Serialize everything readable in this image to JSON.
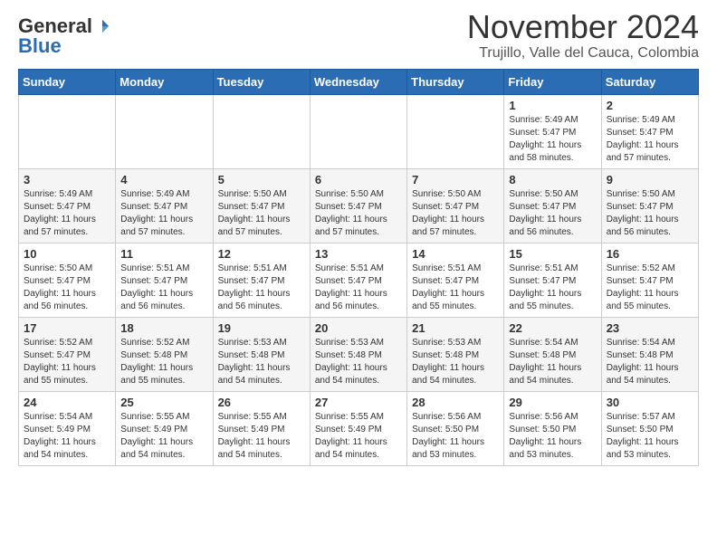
{
  "header": {
    "logo_general": "General",
    "logo_blue": "Blue",
    "title": "November 2024",
    "subtitle": "Trujillo, Valle del Cauca, Colombia"
  },
  "calendar": {
    "headers": [
      "Sunday",
      "Monday",
      "Tuesday",
      "Wednesday",
      "Thursday",
      "Friday",
      "Saturday"
    ],
    "weeks": [
      [
        {
          "day": "",
          "info": ""
        },
        {
          "day": "",
          "info": ""
        },
        {
          "day": "",
          "info": ""
        },
        {
          "day": "",
          "info": ""
        },
        {
          "day": "",
          "info": ""
        },
        {
          "day": "1",
          "info": "Sunrise: 5:49 AM\nSunset: 5:47 PM\nDaylight: 11 hours\nand 58 minutes."
        },
        {
          "day": "2",
          "info": "Sunrise: 5:49 AM\nSunset: 5:47 PM\nDaylight: 11 hours\nand 57 minutes."
        }
      ],
      [
        {
          "day": "3",
          "info": "Sunrise: 5:49 AM\nSunset: 5:47 PM\nDaylight: 11 hours\nand 57 minutes."
        },
        {
          "day": "4",
          "info": "Sunrise: 5:49 AM\nSunset: 5:47 PM\nDaylight: 11 hours\nand 57 minutes."
        },
        {
          "day": "5",
          "info": "Sunrise: 5:50 AM\nSunset: 5:47 PM\nDaylight: 11 hours\nand 57 minutes."
        },
        {
          "day": "6",
          "info": "Sunrise: 5:50 AM\nSunset: 5:47 PM\nDaylight: 11 hours\nand 57 minutes."
        },
        {
          "day": "7",
          "info": "Sunrise: 5:50 AM\nSunset: 5:47 PM\nDaylight: 11 hours\nand 57 minutes."
        },
        {
          "day": "8",
          "info": "Sunrise: 5:50 AM\nSunset: 5:47 PM\nDaylight: 11 hours\nand 56 minutes."
        },
        {
          "day": "9",
          "info": "Sunrise: 5:50 AM\nSunset: 5:47 PM\nDaylight: 11 hours\nand 56 minutes."
        }
      ],
      [
        {
          "day": "10",
          "info": "Sunrise: 5:50 AM\nSunset: 5:47 PM\nDaylight: 11 hours\nand 56 minutes."
        },
        {
          "day": "11",
          "info": "Sunrise: 5:51 AM\nSunset: 5:47 PM\nDaylight: 11 hours\nand 56 minutes."
        },
        {
          "day": "12",
          "info": "Sunrise: 5:51 AM\nSunset: 5:47 PM\nDaylight: 11 hours\nand 56 minutes."
        },
        {
          "day": "13",
          "info": "Sunrise: 5:51 AM\nSunset: 5:47 PM\nDaylight: 11 hours\nand 56 minutes."
        },
        {
          "day": "14",
          "info": "Sunrise: 5:51 AM\nSunset: 5:47 PM\nDaylight: 11 hours\nand 55 minutes."
        },
        {
          "day": "15",
          "info": "Sunrise: 5:51 AM\nSunset: 5:47 PM\nDaylight: 11 hours\nand 55 minutes."
        },
        {
          "day": "16",
          "info": "Sunrise: 5:52 AM\nSunset: 5:47 PM\nDaylight: 11 hours\nand 55 minutes."
        }
      ],
      [
        {
          "day": "17",
          "info": "Sunrise: 5:52 AM\nSunset: 5:47 PM\nDaylight: 11 hours\nand 55 minutes."
        },
        {
          "day": "18",
          "info": "Sunrise: 5:52 AM\nSunset: 5:48 PM\nDaylight: 11 hours\nand 55 minutes."
        },
        {
          "day": "19",
          "info": "Sunrise: 5:53 AM\nSunset: 5:48 PM\nDaylight: 11 hours\nand 54 minutes."
        },
        {
          "day": "20",
          "info": "Sunrise: 5:53 AM\nSunset: 5:48 PM\nDaylight: 11 hours\nand 54 minutes."
        },
        {
          "day": "21",
          "info": "Sunrise: 5:53 AM\nSunset: 5:48 PM\nDaylight: 11 hours\nand 54 minutes."
        },
        {
          "day": "22",
          "info": "Sunrise: 5:54 AM\nSunset: 5:48 PM\nDaylight: 11 hours\nand 54 minutes."
        },
        {
          "day": "23",
          "info": "Sunrise: 5:54 AM\nSunset: 5:48 PM\nDaylight: 11 hours\nand 54 minutes."
        }
      ],
      [
        {
          "day": "24",
          "info": "Sunrise: 5:54 AM\nSunset: 5:49 PM\nDaylight: 11 hours\nand 54 minutes."
        },
        {
          "day": "25",
          "info": "Sunrise: 5:55 AM\nSunset: 5:49 PM\nDaylight: 11 hours\nand 54 minutes."
        },
        {
          "day": "26",
          "info": "Sunrise: 5:55 AM\nSunset: 5:49 PM\nDaylight: 11 hours\nand 54 minutes."
        },
        {
          "day": "27",
          "info": "Sunrise: 5:55 AM\nSunset: 5:49 PM\nDaylight: 11 hours\nand 54 minutes."
        },
        {
          "day": "28",
          "info": "Sunrise: 5:56 AM\nSunset: 5:50 PM\nDaylight: 11 hours\nand 53 minutes."
        },
        {
          "day": "29",
          "info": "Sunrise: 5:56 AM\nSunset: 5:50 PM\nDaylight: 11 hours\nand 53 minutes."
        },
        {
          "day": "30",
          "info": "Sunrise: 5:57 AM\nSunset: 5:50 PM\nDaylight: 11 hours\nand 53 minutes."
        }
      ]
    ]
  }
}
